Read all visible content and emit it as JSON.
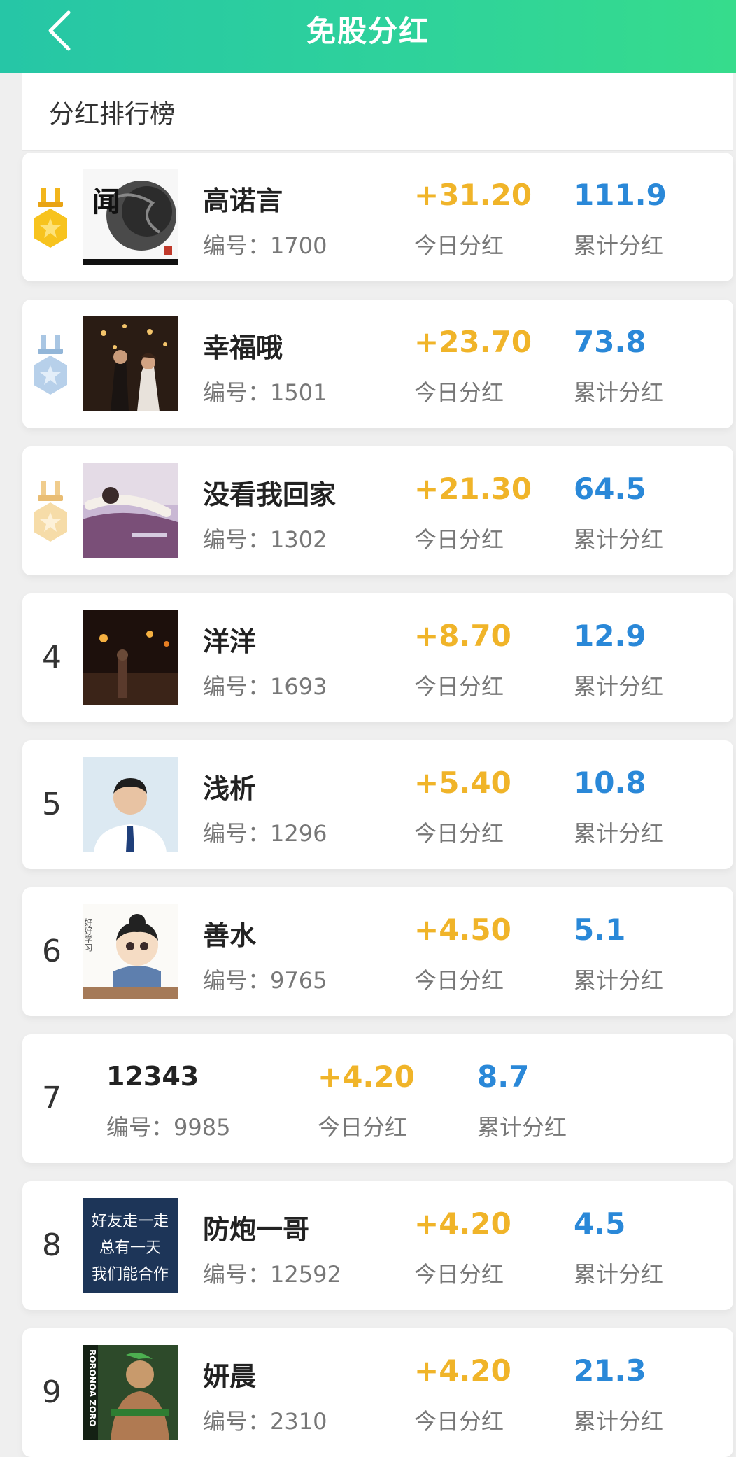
{
  "header": {
    "title": "免股分红",
    "back_icon": "chevron-left-icon"
  },
  "section": {
    "title": "分红排行榜"
  },
  "labels": {
    "today": "今日分红",
    "total": "累计分红"
  },
  "colors": {
    "header_start": "#26c6a6",
    "header_end": "#36dc8c",
    "today": "#f0b429",
    "total": "#2a88d8"
  },
  "ranking": [
    {
      "rank": "",
      "medal": "gold-medal-icon",
      "name": "高诺言",
      "uid": "编号：1700",
      "today": "+31.20",
      "total": "111.9",
      "avatar": "ink-art-avatar"
    },
    {
      "rank": "",
      "medal": "silver-medal-icon",
      "name": "幸福哦",
      "uid": "编号：1501",
      "today": "+23.70",
      "total": "73.8",
      "avatar": "couple-photo-avatar"
    },
    {
      "rank": "",
      "medal": "bronze-medal-icon",
      "name": "没看我回家",
      "uid": "编号：1302",
      "today": "+21.30",
      "total": "64.5",
      "avatar": "purple-photo-avatar"
    },
    {
      "rank": "4",
      "name": "洋洋",
      "uid": "编号：1693",
      "today": "+8.70",
      "total": "12.9",
      "avatar": "night-street-avatar"
    },
    {
      "rank": "5",
      "name": "浅析",
      "uid": "编号：1296",
      "today": "+5.40",
      "total": "10.8",
      "avatar": "portrait-avatar"
    },
    {
      "rank": "6",
      "name": "善水",
      "uid": "编号：9765",
      "today": "+4.50",
      "total": "5.1",
      "avatar": "cartoon-avatar",
      "avatar_text": "好好学习"
    },
    {
      "rank": "7",
      "name": "12343",
      "uid": "编号：9985",
      "today": "+4.20",
      "total": "8.7",
      "avatar": ""
    },
    {
      "rank": "8",
      "name": "防炮一哥",
      "uid": "编号：12592",
      "today": "+4.20",
      "total": "4.5",
      "avatar": "text-poster-avatar",
      "avatar_lines": [
        "好友走一走",
        "总有一天",
        "我们能合作"
      ]
    },
    {
      "rank": "9",
      "name": "妍晨",
      "uid": "编号：2310",
      "today": "+4.20",
      "total": "21.3",
      "avatar": "anime-avatar",
      "avatar_text": "RORONOA ZORO"
    }
  ]
}
